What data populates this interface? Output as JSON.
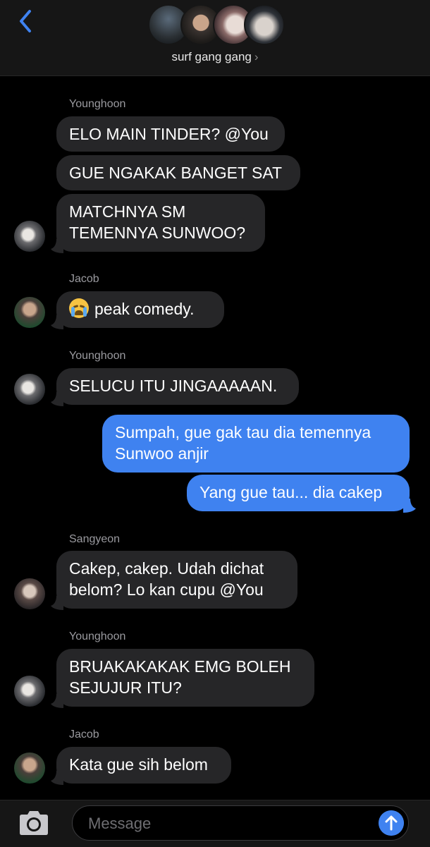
{
  "header": {
    "back_icon": "chevron-left-icon",
    "group_name": "surf gang gang",
    "chevron": "›"
  },
  "colors": {
    "accent": "#3f82f0",
    "incoming_bubble": "#262628",
    "background": "#000000"
  },
  "messages": [
    {
      "sender": "Younghoon",
      "text": "ELO MAIN TINDER? @You"
    },
    {
      "text": "GUE NGAKAK BANGET SAT"
    },
    {
      "text_lines": [
        "MATCHNYA SM",
        "TEMENNYA SUNWOO?"
      ]
    },
    {
      "sender": "Jacob",
      "emoji": "loudly-crying-face",
      "text": "peak comedy."
    },
    {
      "sender": "Younghoon",
      "text": "SELUCU ITU JINGAAAAAN."
    },
    {
      "outgoing": true,
      "text_lines": [
        "Sumpah, gue gak tau dia temennya",
        "Sunwoo anjir"
      ]
    },
    {
      "outgoing": true,
      "text": "Yang gue tau... dia cakep"
    },
    {
      "sender": "Sangyeon",
      "text_lines": [
        "Cakep, cakep. Udah dichat",
        "belom? Lo kan cupu @You"
      ]
    },
    {
      "sender": "Younghoon",
      "text_lines": [
        "BRUAKAKAKAK EMG BOLEH",
        "SEJUJUR ITU?"
      ]
    },
    {
      "sender": "Jacob",
      "text": "Kata gue sih belom"
    }
  ],
  "composer": {
    "placeholder": "Message",
    "camera_icon": "camera-icon",
    "send_icon": "arrow-up-icon"
  }
}
